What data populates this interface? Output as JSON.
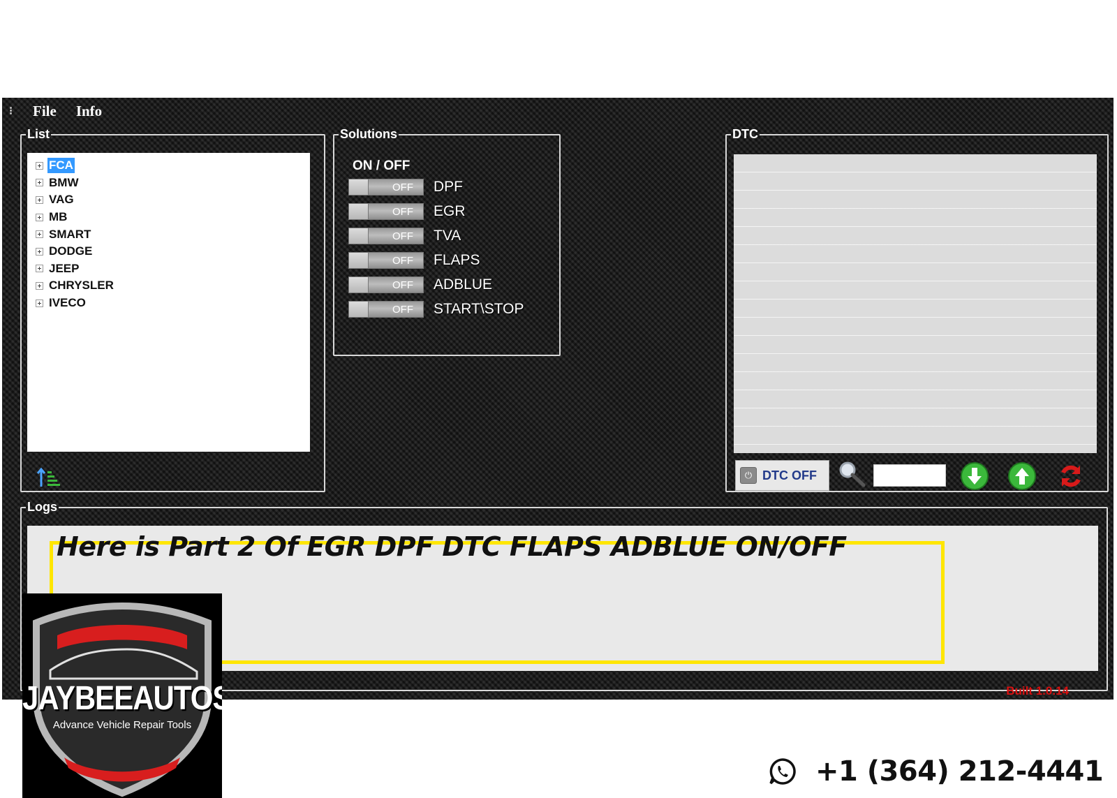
{
  "menu": {
    "file": "File",
    "info": "Info"
  },
  "list": {
    "legend": "List",
    "items": [
      {
        "label": "FCA",
        "selected": true
      },
      {
        "label": "BMW",
        "selected": false
      },
      {
        "label": "VAG",
        "selected": false
      },
      {
        "label": "MB",
        "selected": false
      },
      {
        "label": "SMART",
        "selected": false
      },
      {
        "label": "DODGE",
        "selected": false
      },
      {
        "label": "JEEP",
        "selected": false
      },
      {
        "label": "CHRYSLER",
        "selected": false
      },
      {
        "label": "IVECO",
        "selected": false
      }
    ],
    "sort_icon": "sort-ascending-icon"
  },
  "solutions": {
    "legend": "Solutions",
    "header": "ON  /  OFF",
    "items": [
      {
        "label": "DPF",
        "state": "OFF"
      },
      {
        "label": "EGR",
        "state": "OFF"
      },
      {
        "label": "TVA",
        "state": "OFF"
      },
      {
        "label": "FLAPS",
        "state": "OFF"
      },
      {
        "label": "ADBLUE",
        "state": "OFF"
      },
      {
        "label": "START\\STOP",
        "state": "OFF"
      }
    ]
  },
  "dtc": {
    "legend": "DTC",
    "off_button": "DTC OFF",
    "search_value": "",
    "icons": [
      "power-icon",
      "magnifier-icon",
      "download-arrow-icon",
      "upload-arrow-icon",
      "refresh-icon"
    ],
    "colors": {
      "arrow_green": "#3bb83b",
      "refresh_red": "#d81a1a"
    }
  },
  "logs": {
    "legend": "Logs",
    "headline": "Here is Part 2 Of EGR DPF DTC FLAPS ADBLUE ON/OFF",
    "highlight_color": "#ffe600"
  },
  "build": "Built 1.0.14",
  "brand": {
    "name": "JAYBEEAUTOS",
    "tagline": "Advance Vehicle Repair Tools",
    "colors": {
      "red": "#d81e1e",
      "silver": "#b8b8b8"
    }
  },
  "contact": {
    "phone": "+1 (364) 212-4441",
    "icon": "whatsapp-icon"
  }
}
